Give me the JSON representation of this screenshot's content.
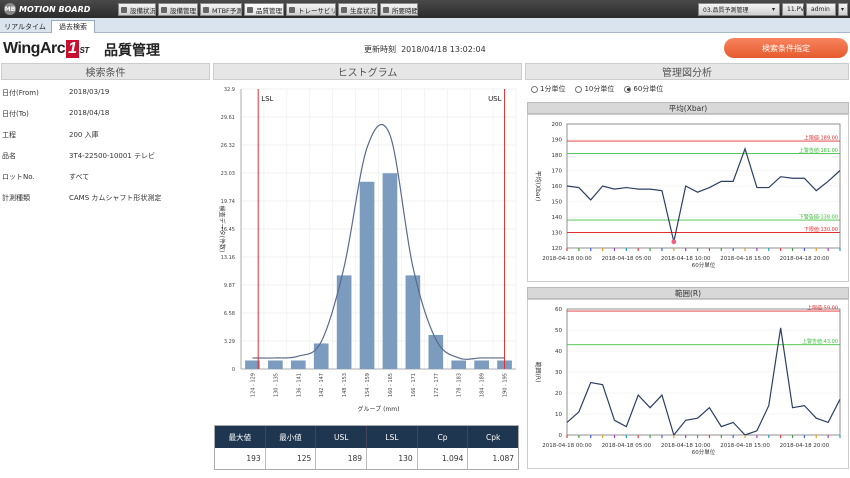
{
  "app": {
    "logo_text": "MOTION BOARD",
    "logo_badge": "MB"
  },
  "top_tabs": [
    "設備状況",
    "設備管理",
    "MTBF予測",
    "品質管理",
    "トレーサビリティ",
    "生産状況",
    "所要時間"
  ],
  "top_right": {
    "dropdown": "03.品質予測管理",
    "pv": "11.PV",
    "user": "admin"
  },
  "sub_tabs": [
    "リアルタイム",
    "過去検索"
  ],
  "header": {
    "brand_a": "WingArc",
    "brand_one": "1",
    "brand_st": "ST",
    "title": "品質管理",
    "updated_label": "更新時刻",
    "updated_value": "2018/04/18 13:02:04",
    "search_button": "検索条件指定"
  },
  "panels": {
    "conditions": "検索条件",
    "histogram": "ヒストグラム",
    "control": "管理図分析"
  },
  "conditions": [
    {
      "label": "日付(From)",
      "value": "2018/03/19"
    },
    {
      "label": "日付(To)",
      "value": "2018/04/18"
    },
    {
      "label": "工程",
      "value": "200 入庫"
    },
    {
      "label": "品名",
      "value": "3T4-22500-10001 テレビ"
    },
    {
      "label": "ロットNo.",
      "value": "すべて"
    },
    {
      "label": "計測種類",
      "value": "CAMS カムシャフト形状測定"
    }
  ],
  "stats": {
    "headers": [
      "最大値",
      "最小値",
      "USL",
      "LSL",
      "Cp",
      "Cpk"
    ],
    "values": [
      "193",
      "125",
      "189",
      "130",
      "1.094",
      "1.087"
    ]
  },
  "radios": [
    {
      "label": "1分単位",
      "selected": false
    },
    {
      "label": "10分単位",
      "selected": false
    },
    {
      "label": "60分単位",
      "selected": true
    }
  ],
  "chart_data": [
    {
      "type": "bar",
      "categories": [
        "124 - 129",
        "130 - 135",
        "136 - 141",
        "142 - 147",
        "148 - 153",
        "154 - 159",
        "160 - 165",
        "166 - 171",
        "172 - 177",
        "178 - 183",
        "184 - 189",
        "190 - 195"
      ],
      "values": [
        1,
        1,
        1,
        3,
        11,
        22,
        23,
        11,
        4,
        1,
        1,
        1
      ],
      "curve": [
        1.3,
        1.3,
        1.5,
        3.2,
        12,
        26,
        27.5,
        12,
        3.5,
        1.3,
        1.3,
        1.3
      ],
      "ylim": [
        0,
        32.9
      ],
      "yticks": [
        "0",
        "3.29",
        "6.58",
        "9.87",
        "13.16",
        "16.45",
        "19.74",
        "23.03",
        "26.32",
        "29.61",
        "32.9"
      ],
      "xlabel": "グループ (mm)",
      "ylabel": "検査データ(件数)",
      "lsl_label": "LSL",
      "usl_label": "USL",
      "lsl_index": 0.75,
      "usl_index": 11.5,
      "colors": {
        "bar": "#7b9bbf",
        "curve": "#5a6a8a",
        "limit": "#e03030"
      }
    },
    {
      "type": "line",
      "title": "平均(Xbar)",
      "ylabel": "平均(Xbar)",
      "xlabel": "60分単位",
      "ylim": [
        120,
        200
      ],
      "yticks": [
        "120",
        "130",
        "140",
        "150",
        "160",
        "170",
        "180",
        "190",
        "200"
      ],
      "xticks": [
        "2018-04-18 00:00",
        "2018-04-18 05:00",
        "2018-04-18 10:00",
        "2018-04-18 15:00",
        "2018-04-18 20:00"
      ],
      "values": [
        160,
        159,
        151,
        160,
        158,
        159,
        158,
        158,
        157,
        124,
        160,
        156,
        159,
        163,
        163,
        184,
        159,
        159,
        166,
        165,
        165,
        157,
        163,
        170
      ],
      "limits": [
        {
          "label": "上限値:189.00",
          "value": 189,
          "color": "#e03030"
        },
        {
          "label": "上警告値:181.00",
          "value": 181,
          "color": "#40c040"
        },
        {
          "label": "下警告値:138.00",
          "value": 138,
          "color": "#40c040"
        },
        {
          "label": "下限値:130.00",
          "value": 130,
          "color": "#e03030"
        }
      ],
      "outlier_index": 9
    },
    {
      "type": "line",
      "title": "範囲(R)",
      "ylabel": "範囲(R)",
      "xlabel": "60分単位",
      "ylim": [
        0,
        60
      ],
      "yticks": [
        "0",
        "10",
        "20",
        "30",
        "40",
        "50",
        "60"
      ],
      "xticks": [
        "2018-04-18 00:00",
        "2018-04-18 05:00",
        "2018-04-18 10:00",
        "2018-04-18 15:00",
        "2018-04-18 20:00"
      ],
      "values": [
        6,
        11,
        25,
        24,
        7,
        4,
        19,
        13,
        19,
        0,
        7,
        8,
        13,
        4,
        6,
        0,
        2,
        14,
        51,
        13,
        14,
        8,
        6,
        17
      ],
      "limits": [
        {
          "label": "上限値:59.00",
          "value": 59,
          "color": "#e03030"
        },
        {
          "label": "上警告値:43.00",
          "value": 43,
          "color": "#40c040"
        }
      ]
    }
  ]
}
